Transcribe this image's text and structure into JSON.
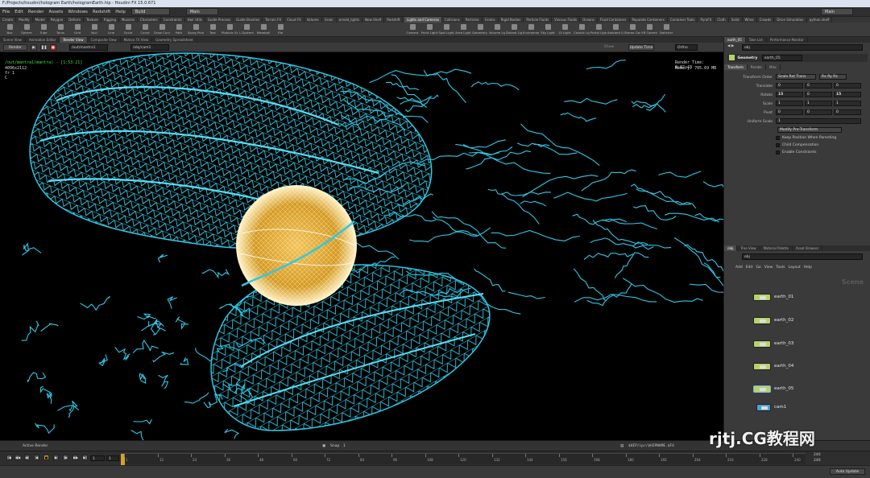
{
  "titlebar": {
    "text": "F:/Projects/houdini/hologram Earth/hologramEarth.hip - Houdini FX 15.0.671"
  },
  "menu": {
    "items": [
      "File",
      "Edit",
      "Render",
      "Assets",
      "Windows",
      "Redshift",
      "Help"
    ],
    "desktop_value": "Build",
    "object_value": "Main",
    "right_value": "Main"
  },
  "shelf_tabs": {
    "left": [
      "Create",
      "Modify",
      "Model",
      "Polygon",
      "Deform",
      "Texture",
      "Rigging",
      "Muscles",
      "Characters",
      "Constraints",
      "Hair Utils",
      "Guide Process",
      "Guide Brushes",
      "Terrain FX",
      "Cloud FX",
      "Volume",
      "Grain",
      "arnold_lights",
      "New Shelf",
      "Redshift"
    ],
    "right": [
      "Lights and Cameras",
      "Collisions",
      "Particles",
      "Grains",
      "Rigid Bodies",
      "Particle Fluids",
      "Viscous Fluids",
      "Oceans",
      "Fluid Containers",
      "Populate Containers",
      "Container Tools",
      "PyroFX",
      "Cloth",
      "Solid",
      "Wires",
      "Crowds",
      "Drive Simulation",
      "python.shelf"
    ],
    "right_selected": 0
  },
  "shelf_tools": {
    "left": [
      "Box",
      "Sphere",
      "Tube",
      "Torus",
      "Grid",
      "Null",
      "Line",
      "Circle",
      "Curve",
      "Draw Curve",
      "Path",
      "Spray Paint",
      "Text",
      "Platonic Solids",
      "L-System",
      "Metaball",
      "File"
    ],
    "right": [
      "Camera",
      "Point Light",
      "Spot Light",
      "Area Light",
      "Geometry Light",
      "Volume Light",
      "Distant Light",
      "Environment Light",
      "Sky Light",
      "GI Light",
      "Caustic Light",
      "Portal Light",
      "Ambient Light",
      "Stereo Camera",
      "VR Camera",
      "Switcher"
    ]
  },
  "pane_tabs": [
    "Scene View",
    "Animation Editor",
    "Render View",
    "Composite View",
    "Motion FX View",
    "Geometry Spreadsheet"
  ],
  "pane_tabs_selected": 2,
  "viewport_toolbar": {
    "render_label": "Render",
    "rop_value": "/out/mantra1",
    "camera_value": "/obj/cam1",
    "show_label": "Show",
    "update_label": "Update Time",
    "mode_value": "Ortho"
  },
  "overlay": {
    "path": "/out/mantra1(mantra) - [1:53:21]",
    "line2": "4096x2112",
    "line3": "fr 1",
    "line4": "C",
    "render_time": "Render Time: 0:02:43",
    "memory": "Memory:   705.69 MB"
  },
  "param_panel": {
    "top_tabs": [
      "earth_05",
      "Take List",
      "Performance Monitor"
    ],
    "node_type": "Geometry",
    "node_name": "earth_05",
    "path_value": "obj",
    "tabs": [
      "Transform",
      "Render",
      "Misc"
    ],
    "rows": [
      {
        "label": "Transform Order",
        "values": [
          "Scale Rot Trans",
          "Rx Ry Rz"
        ]
      },
      {
        "label": "Translate",
        "values": [
          "0",
          "0",
          "0"
        ]
      },
      {
        "label": "Rotate",
        "values": [
          "15",
          "0",
          "15"
        ]
      },
      {
        "label": "Scale",
        "values": [
          "1",
          "1",
          "1"
        ]
      },
      {
        "label": "Pivot",
        "values": [
          "0",
          "0",
          "0"
        ]
      },
      {
        "label": "Uniform Scale",
        "values": [
          "1"
        ]
      }
    ],
    "modify_value": "Modify Pre-Transform",
    "checkboxes": [
      "Keep Position When Parenting",
      "Child Compensation",
      "Enable Constraints"
    ]
  },
  "network_panel": {
    "tabs": [
      "/obj",
      "Tree View",
      "Material Palette",
      "Asset Browser"
    ],
    "path_value": "obj",
    "menu": [
      "Add",
      "Edit",
      "Go",
      "View",
      "Tools",
      "Layout",
      "Help"
    ],
    "context_label": "Scene",
    "nodes": [
      "earth_01",
      "earth_02",
      "earth_03",
      "earth_04",
      "earth_05",
      "cam1"
    ],
    "colors": {
      "geo": "#b6d36a",
      "geo_selected": "#7ab4e8",
      "cam": "#4f9fd6"
    }
  },
  "playbar": {
    "left_label": "Active Render",
    "snap_label": "Snap",
    "snap_value": "1",
    "file_value": "$HIP/ipr/$HIPNAME.$F4"
  },
  "timeline": {
    "current_frame": "1",
    "start_frame": "1",
    "ticks": [
      "1",
      "12",
      "24",
      "36",
      "48",
      "60",
      "72",
      "84",
      "96",
      "108",
      "120",
      "132",
      "144",
      "156",
      "168",
      "180",
      "192",
      "204",
      "216",
      "228",
      "240"
    ],
    "end_a": "240",
    "end_b": "240",
    "auto_update": "Auto Update"
  },
  "watermark": {
    "text": "rjtj.CG教程网"
  },
  "colors": {
    "wire": "#2ec8e6",
    "core": "#e8b13a",
    "playhead": "#d8a226"
  }
}
